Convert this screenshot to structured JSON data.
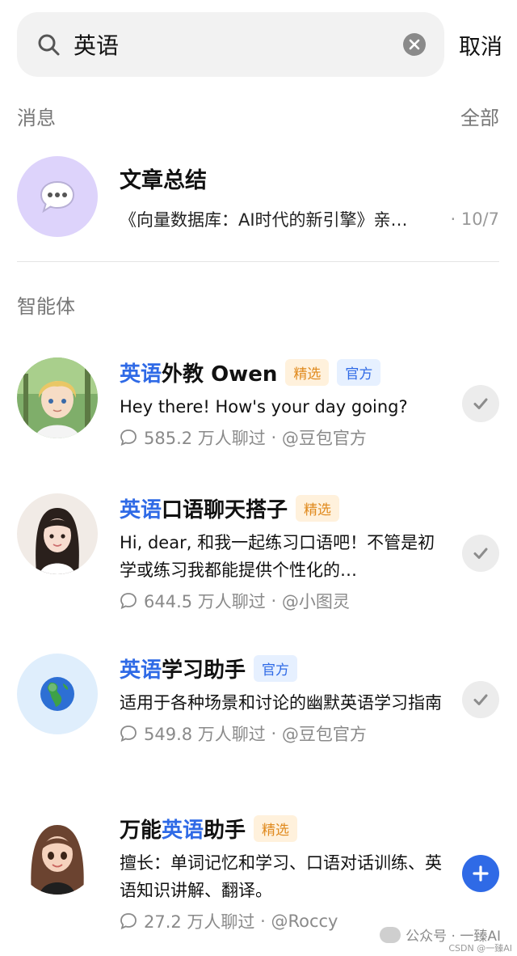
{
  "search": {
    "value": "英语",
    "cancel_label": "取消"
  },
  "messages_section": {
    "label": "消息",
    "all_label": "全部",
    "items": [
      {
        "title": "文章总结",
        "preview": "《向量数据库：AI时代的新引擎》亲…",
        "time": "· 10/7",
        "avatar_icon": "speech-bubble-icon",
        "avatar_color": "#ddd3fb"
      }
    ]
  },
  "agents_section": {
    "label": "智能体",
    "items": [
      {
        "name_highlight": "英语",
        "name_rest": "外教 Owen",
        "badges": [
          "精选",
          "官方"
        ],
        "desc": "Hey there! How's your day going?",
        "chats": "585.2 万人聊过",
        "creator": "@豆包官方",
        "action": "added"
      },
      {
        "name_highlight": "英语",
        "name_rest": "口语聊天搭子",
        "badges": [
          "精选"
        ],
        "desc": "Hi, dear, 和我一起练习口语吧！不管是初学或练习我都能提供个性化的…",
        "chats": "644.5 万人聊过",
        "creator": "@小图灵",
        "action": "added"
      },
      {
        "name_highlight": "英语",
        "name_rest": "学习助手",
        "badges": [
          "官方"
        ],
        "desc": "适用于各种场景和讨论的幽默英语学习指南",
        "chats": "549.8 万人聊过",
        "creator": "@豆包官方",
        "action": "added"
      },
      {
        "name_prefix": "万能",
        "name_highlight": "英语",
        "name_rest": "助手",
        "badges": [
          "精选"
        ],
        "desc": "擅长：单词记忆和学习、口语对话训练、英语知识讲解、翻译。",
        "chats": "27.2 万人聊过",
        "creator": "@Roccy",
        "action": "add"
      }
    ]
  },
  "watermark": {
    "text": "公众号 · 一臻AI",
    "csdn": "CSDN @一臻AI"
  },
  "colors": {
    "accent": "#2f6ae6",
    "pick_badge": "#e08a1e",
    "official_badge": "#2f6ae6"
  }
}
